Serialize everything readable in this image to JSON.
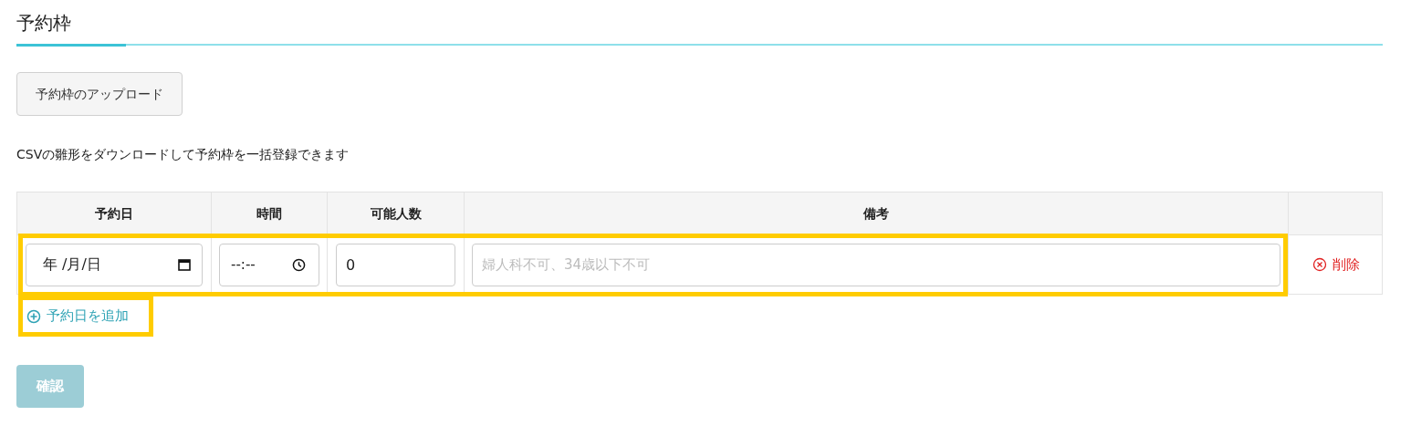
{
  "page_title": "予約枠",
  "upload_button": "予約枠のアップロード",
  "description": "CSVの雛形をダウンロードして予約枠を一括登録できます",
  "table": {
    "columns": [
      "予約日",
      "時間",
      "可能人数",
      "備考"
    ],
    "rows": [
      {
        "date": "年 /月/日",
        "time": "--:--",
        "capacity": "0",
        "note_placeholder": "婦人科不可、34歳以下不可",
        "delete": "削除"
      }
    ]
  },
  "add_link": "予約日を追加",
  "confirm_button": {
    "label": "確認",
    "disabled": true
  }
}
